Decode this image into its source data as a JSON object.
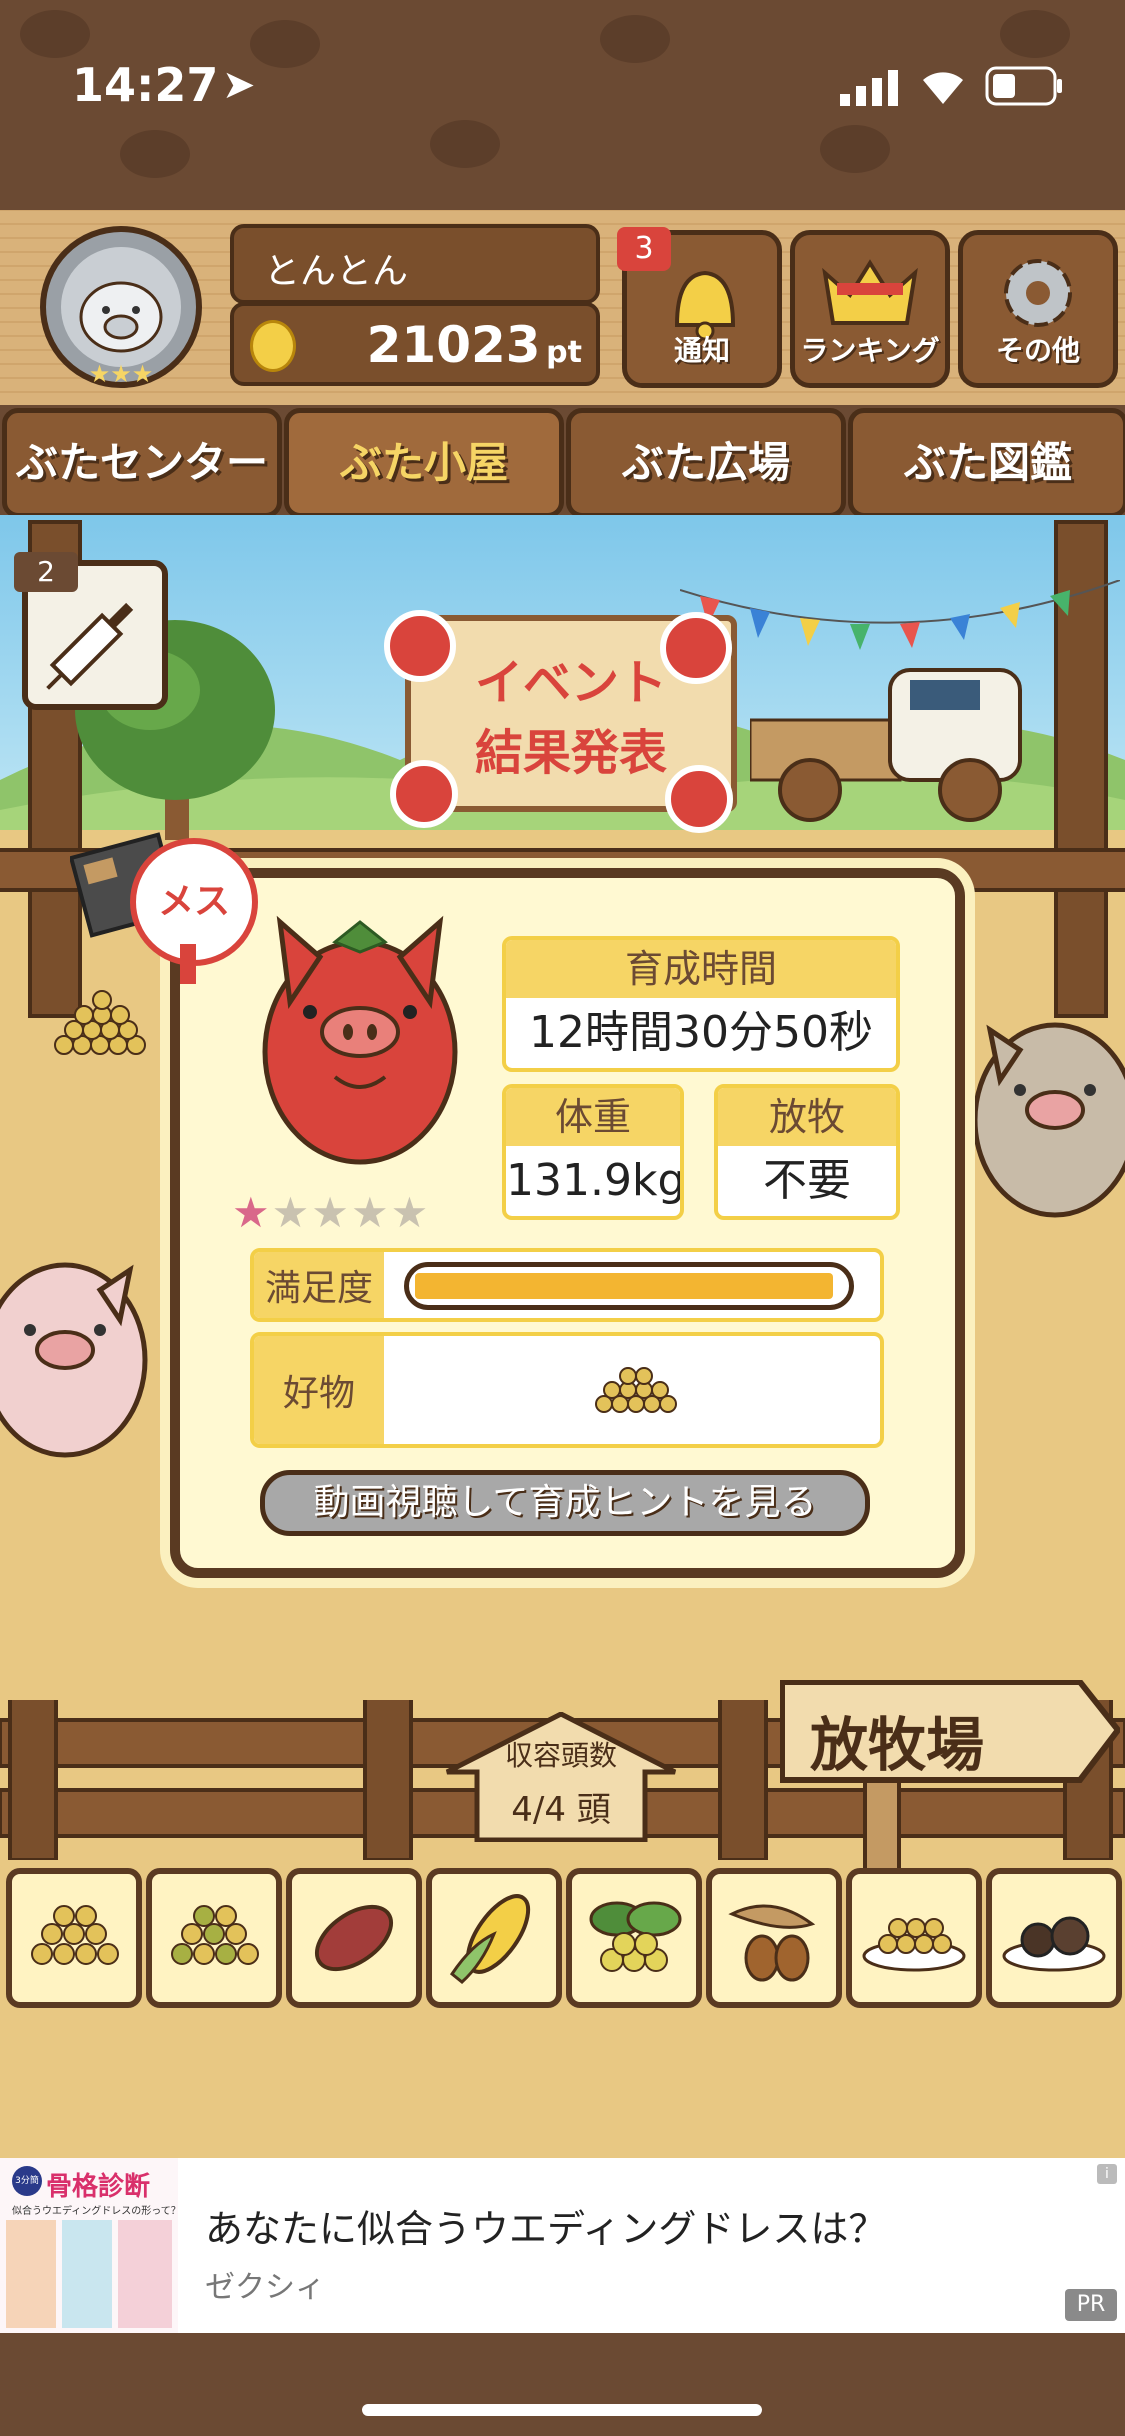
{
  "status_bar": {
    "time": "14:27"
  },
  "header": {
    "player_name": "とんとん",
    "points": "21023",
    "points_unit": "pt",
    "notification_badge": "3",
    "buttons": [
      {
        "label": "通知",
        "icon": "bell-icon"
      },
      {
        "label": "ランキング",
        "icon": "crown-icon"
      },
      {
        "label": "その他",
        "icon": "gear-icon"
      }
    ]
  },
  "nav": {
    "tabs": [
      "ぶたセンター",
      "ぶた小屋",
      "ぶた広場",
      "ぶた図鑑"
    ]
  },
  "syringe_count": "2",
  "event_sign": {
    "line1": "イベント",
    "line2": "結果発表"
  },
  "pig_panel": {
    "gender_label": "メス",
    "stars_filled": 1,
    "stars_total": 5,
    "growth_time_label": "育成時間",
    "growth_time_value": "12時間30分50秒",
    "weight_label": "体重",
    "weight_value": "131.9kg",
    "grazing_label": "放牧",
    "grazing_value": "不要",
    "satisfaction_label": "満足度",
    "satisfaction_level": 1.0,
    "favorite_label": "好物",
    "hint_button": "動画視聴して育成ヒントを見る"
  },
  "capacity_sign": {
    "label": "収容頭数",
    "value": "4/4 頭"
  },
  "pasture_sign": "放牧場",
  "feeds": [
    "soybean-icon",
    "mixed-beans-icon",
    "sweet-potato-icon",
    "corn-icon",
    "herb-berries-icon",
    "acorn-icon",
    "bowl-beans-icon",
    "truffle-icon"
  ],
  "ad": {
    "image_title": "骨格診断",
    "image_caption": "似合うウエディングドレスの形って？",
    "image_tag": "3分簡単",
    "title": "あなたに似合うウエディングドレスは？",
    "sponsor": "ゼクシィ",
    "pr_label": "PR",
    "info_label": "i"
  },
  "colors": {
    "wood_dark": "#5a3a22",
    "wood": "#8a5a33",
    "panel_bg": "#fff9d2",
    "accent_yellow": "#f6d565",
    "pig_red": "#d9443c"
  }
}
